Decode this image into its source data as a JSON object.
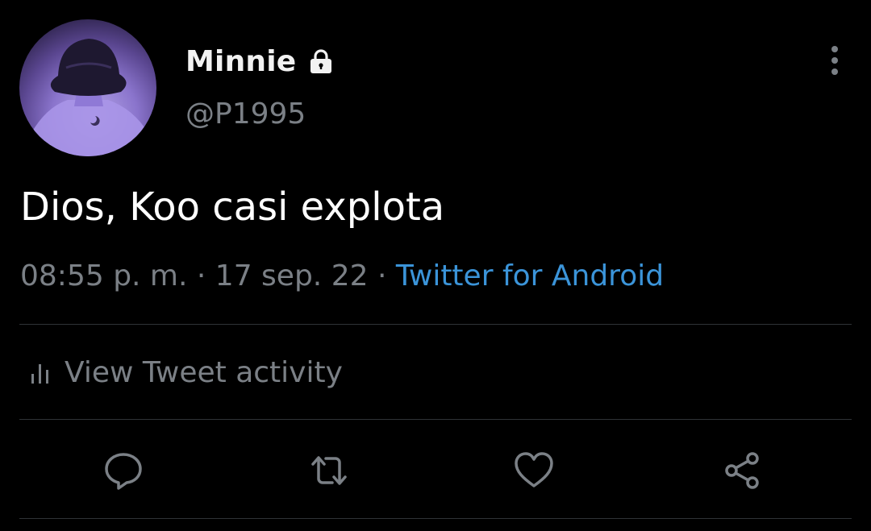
{
  "tweet": {
    "author": {
      "display_name": "Minnie",
      "handle": "@P1995",
      "protected_icon": "lock-icon"
    },
    "text": "Dios, Koo casi explota",
    "meta": {
      "time": "08:55 p. m.",
      "sep1": " · ",
      "date": "17 sep. 22",
      "sep2": " · ",
      "source": "Twitter for Android"
    },
    "activity_label": "View Tweet activity",
    "actions": {
      "reply_icon": "reply-icon",
      "retweet_icon": "retweet-icon",
      "like_icon": "heart-icon",
      "share_icon": "share-icon"
    }
  },
  "colors": {
    "background": "#000000",
    "text": "#ffffff",
    "secondary": "#7b8086",
    "link": "#3b94d9",
    "divider": "#2f3336"
  }
}
